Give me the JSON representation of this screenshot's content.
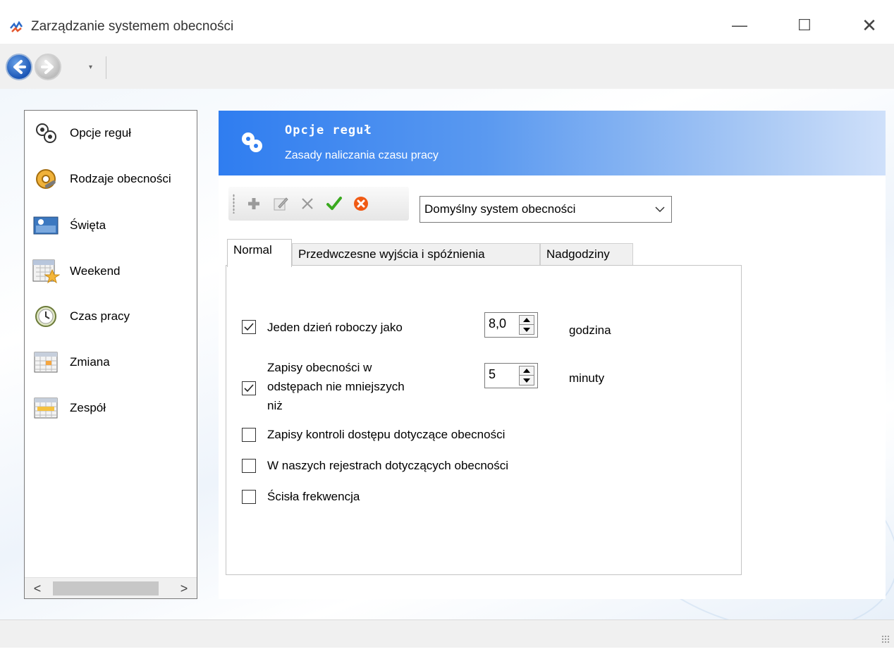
{
  "window": {
    "title": "Zarządzanie systemem obecności",
    "minimize_glyph": "—",
    "maximize_glyph": "☐",
    "close_glyph": "✕"
  },
  "navigation": {
    "back_icon": "back-arrow-icon",
    "forward_icon": "forward-arrow-icon",
    "dropdown_glyph": "▾"
  },
  "sidebar": {
    "items": [
      {
        "label": "Opcje reguł",
        "icon": "gears-icon"
      },
      {
        "label": "Rodzaje obecności",
        "icon": "gear-wrench-icon"
      },
      {
        "label": "Święta",
        "icon": "holiday-picture-icon"
      },
      {
        "label": "Weekend",
        "icon": "calendar-star-icon"
      },
      {
        "label": "Czas pracy",
        "icon": "clock-icon"
      },
      {
        "label": "Zmiana",
        "icon": "shift-grid-icon"
      },
      {
        "label": "Zespół",
        "icon": "team-grid-icon"
      }
    ],
    "scroll_left": "<",
    "scroll_right": ">"
  },
  "header": {
    "title": "Opcje reguł",
    "subtitle": "Zasady naliczania czasu pracy"
  },
  "toolbar": {
    "buttons": [
      "add-icon",
      "edit-icon",
      "delete-icon",
      "confirm-icon",
      "cancel-icon"
    ]
  },
  "system_combo": {
    "value": "Domyślny system obecności"
  },
  "tabs": [
    {
      "label": "Normal",
      "active": true
    },
    {
      "label": "Przedwczesne wyjścia i spóźnienia",
      "active": false
    },
    {
      "label": "Nadgodziny",
      "active": false
    }
  ],
  "options": {
    "workday": {
      "label": "Jeden dzień roboczy jako",
      "checked": true,
      "value": "8,0",
      "unit": "godzina"
    },
    "interval": {
      "label_lines": [
        "Zapisy obecności w",
        "odstępach nie mniejszych",
        "niż"
      ],
      "checked": true,
      "value": "5",
      "unit": "minuty"
    },
    "access_control": {
      "label": "Zapisy kontroli dostępu dotyczące obecności",
      "checked": false
    },
    "our_records": {
      "label": "W naszych rejestrach dotyczących obecności",
      "checked": false
    },
    "strict": {
      "label": "Ścisła frekwencja",
      "checked": false
    }
  },
  "colors": {
    "header_start": "#2f7df0",
    "header_end": "#cfe0fa",
    "confirm_green": "#3aa91f",
    "cancel_orange": "#f05a14"
  }
}
